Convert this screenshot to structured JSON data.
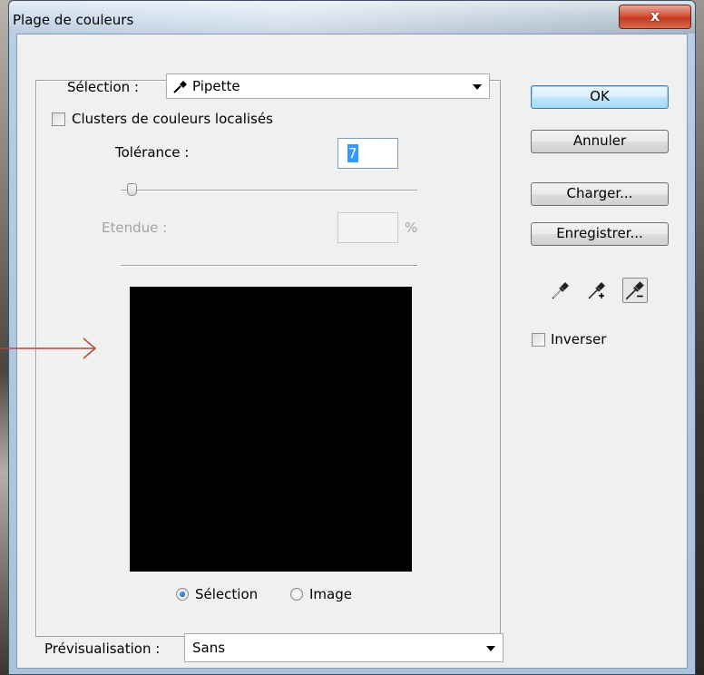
{
  "window": {
    "title": "Plage de couleurs",
    "close_label": "x"
  },
  "selection": {
    "label": "Sélection :",
    "value": "Pipette",
    "icon": "eyedropper-icon"
  },
  "clusters": {
    "label": "Clusters de couleurs localisés",
    "checked": false
  },
  "tolerance": {
    "label": "Tolérance :",
    "value": "7",
    "slider_value": 7
  },
  "range": {
    "label": "Etendue :",
    "value": "",
    "unit": "%"
  },
  "preview_mode": {
    "options": [
      "Sélection",
      "Image"
    ],
    "selected": "Sélection"
  },
  "previsualisation": {
    "label": "Prévisualisation :",
    "value": "Sans"
  },
  "buttons": {
    "ok": "OK",
    "cancel": "Annuler",
    "load": "Charger...",
    "save": "Enregistrer..."
  },
  "eyedroppers": [
    "eyedropper-icon",
    "eyedropper-plus-icon",
    "eyedropper-minus-icon"
  ],
  "invert": {
    "label": "Inverser",
    "checked": false
  },
  "colors": {
    "annotation_arrow": "#b5473a",
    "selection_highlight": "#3399ff",
    "close_button": "#c94a30"
  }
}
